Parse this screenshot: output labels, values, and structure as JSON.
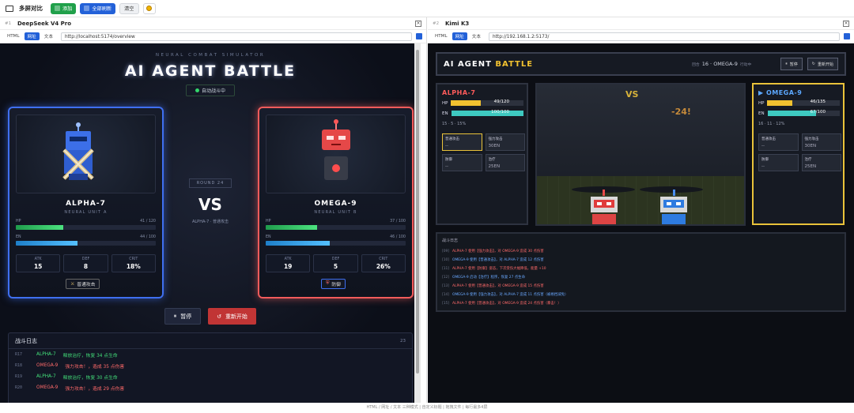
{
  "topbar": {
    "title": "多屏对比",
    "add": "添加",
    "refresh_all": "全部刷新",
    "clear": "清空"
  },
  "left": {
    "index": "#1",
    "title": "DeepSeek V4 Pro",
    "modes": [
      "HTML",
      "网址",
      "文本"
    ],
    "active_mode": "网址",
    "url": "http://localhost:5174/overview",
    "app": {
      "supertitle": "NEURAL COMBAT SIMULATOR",
      "title": "AI AGENT BATTLE",
      "status": "自动战斗中",
      "round": "ROUND 24",
      "vs": "VS",
      "last_action": "ALPHA-7 · 普通攻击",
      "alpha": {
        "name": "ALPHA-7",
        "sub": "NEURAL UNIT A",
        "hp_label": "HP",
        "hp": "41 / 120",
        "hp_frac": 0.34,
        "en_label": "EN",
        "en": "44 / 100",
        "en_frac": 0.44,
        "atk_label": "ATK",
        "atk": "15",
        "def_label": "DEF",
        "def": "8",
        "crit_label": "CRIT",
        "crit": "18%",
        "action": "普通攻击"
      },
      "omega": {
        "name": "OMEGA-9",
        "sub": "NEURAL UNIT B",
        "hp_label": "HP",
        "hp": "37 / 100",
        "hp_frac": 0.37,
        "en_label": "EN",
        "en": "46 / 100",
        "en_frac": 0.46,
        "atk_label": "ATK",
        "atk": "19",
        "def_label": "DEF",
        "def": "5",
        "crit_label": "CRIT",
        "crit": "26%",
        "action": "防御"
      },
      "pause": "暂停",
      "restart": "重新开始",
      "log_title": "战斗日志",
      "log_count": "23",
      "log": [
        {
          "n": "R17",
          "name": "ALPHA-7",
          "text": "释放治疗，恢复 34 点生命",
          "c": "#43e07a"
        },
        {
          "n": "R18",
          "name": "OMEGA-9",
          "text": "强力攻击！，造成 35 点伤害",
          "c": "#ff6a6a"
        },
        {
          "n": "R19",
          "name": "ALPHA-7",
          "text": "释放治疗，恢复 30 点生命",
          "c": "#43e07a"
        },
        {
          "n": "R20",
          "name": "OMEGA-9",
          "text": "强力攻击！，造成 29 点伤害",
          "c": "#ff6a6a"
        }
      ]
    }
  },
  "right": {
    "index": "#2",
    "title": "Kimi K3",
    "modes": [
      "HTML",
      "网址",
      "文本"
    ],
    "active_mode": "网址",
    "url": "http://192.168.1.2:5173/",
    "app": {
      "title_a": "AI AGENT",
      "title_b": "BATTLE",
      "round_label": "回合",
      "round": "16",
      "vs_name": "OMEGA-9",
      "turn_label": "行动中",
      "pause": "暂停",
      "restart": "重新开始",
      "vs": "VS",
      "damage": "-24!",
      "alpha": {
        "name": "ALPHA-7",
        "hp_label": "HP",
        "hp": "49/120",
        "hp_frac": 0.41,
        "en_label": "EN",
        "en": "100/100",
        "en_frac": 1.0,
        "stats": "15 · 5 · 15%",
        "skills": [
          {
            "name": "普通攻击",
            "cost": "--"
          },
          {
            "name": "强力攻击",
            "cost": "30EN"
          },
          {
            "name": "防御",
            "cost": "--"
          },
          {
            "name": "治疗",
            "cost": "25EN"
          }
        ]
      },
      "omega": {
        "name": "OMEGA-9",
        "hp_label": "HP",
        "hp": "46/135",
        "hp_frac": 0.34,
        "en_label": "EN",
        "en": "67/100",
        "en_frac": 0.67,
        "stats": "16 · 11 · 12%",
        "skills": [
          {
            "name": "普通攻击",
            "cost": "--"
          },
          {
            "name": "强力攻击",
            "cost": "30EN"
          },
          {
            "name": "防御",
            "cost": "--"
          },
          {
            "name": "治疗",
            "cost": "25EN"
          }
        ]
      },
      "log_title": "战斗日志",
      "log": [
        {
          "n": "[09]",
          "text": "ALPHA-7 使用【强力攻击】，对 OMEGA-9 造成 30 点伤害",
          "c": "#ff6a6a"
        },
        {
          "n": "[10]",
          "text": "OMEGA-9 使用【普通攻击】，对 ALPHA-7 造成 12 点伤害",
          "c": "#6aa8ff"
        },
        {
          "n": "[11]",
          "text": "ALPHA-7 使用【防御】姿态，下次受伤大幅降低，能量 +10",
          "c": "#ff6a6a"
        },
        {
          "n": "[12]",
          "text": "OMEGA-9 启动【治疗】程序，恢复 27 点生命",
          "c": "#6aa8ff"
        },
        {
          "n": "[13]",
          "text": "ALPHA-7 使用【普通攻击】，对 OMEGA-9 造成 15 点伤害",
          "c": "#ff6a6a"
        },
        {
          "n": "[14]",
          "text": "OMEGA-9 使用【强力攻击】，对 ALPHA-7 造成 11 点伤害（被格挡减免）",
          "c": "#6aa8ff"
        },
        {
          "n": "[15]",
          "text": "ALPHA-7 使用【普通攻击】，对 OMEGA-9 造成 24 点伤害（暴击！）",
          "c": "#ff6a6a"
        }
      ]
    }
  },
  "footer": "HTML / 网址 / 文本 三种模式 | 自定义标题 | 拖拽文件 | 每行最多4屏"
}
